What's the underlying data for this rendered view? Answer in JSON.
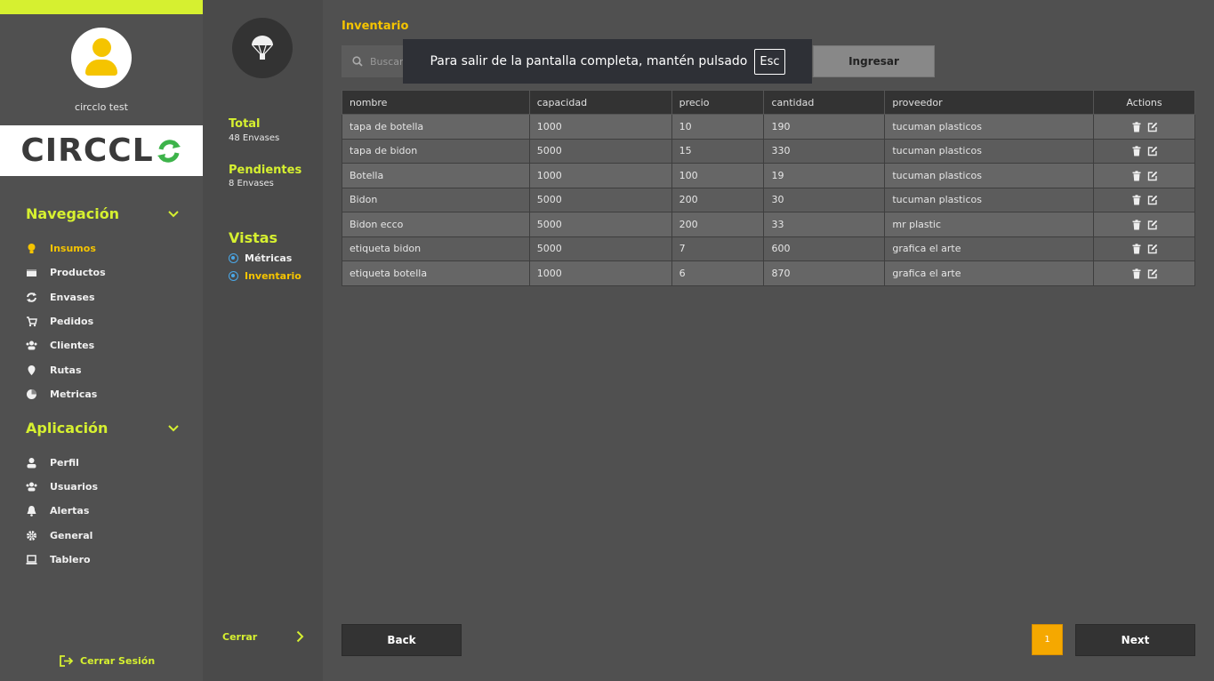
{
  "sidebar": {
    "username": "circclo test",
    "logo_text": "CIRCCL",
    "nav_heading": "Navegación",
    "nav_items": [
      {
        "label": "Insumos",
        "icon": "lightbulb-icon"
      },
      {
        "label": "Productos",
        "icon": "box-icon"
      },
      {
        "label": "Envases",
        "icon": "recycle-icon"
      },
      {
        "label": "Pedidos",
        "icon": "cart-icon"
      },
      {
        "label": "Clientes",
        "icon": "users-icon"
      },
      {
        "label": "Rutas",
        "icon": "map-pin-icon"
      },
      {
        "label": "Metricas",
        "icon": "pie-chart-icon"
      }
    ],
    "app_heading": "Aplicación",
    "app_items": [
      {
        "label": "Perfil",
        "icon": "user-icon"
      },
      {
        "label": "Usuarios",
        "icon": "users-icon"
      },
      {
        "label": "Alertas",
        "icon": "bell-icon"
      },
      {
        "label": "General",
        "icon": "gear-icon"
      },
      {
        "label": "Tablero",
        "icon": "laptop-icon"
      }
    ],
    "logout_label": "Cerrar Sesión"
  },
  "column2": {
    "total_title": "Total",
    "total_sub": "48 Envases",
    "pending_title": "Pendientes",
    "pending_sub": "8 Envases",
    "vistas_title": "Vistas",
    "vistas": [
      "Métricas",
      "Inventario"
    ],
    "close_label": "Cerrar"
  },
  "main": {
    "title": "Inventario",
    "search_placeholder": "Buscar",
    "submit_label": "Ingresar",
    "fullscreen_notice": "Para salir de la pantalla completa, mantén pulsado",
    "fullscreen_key": "Esc",
    "columns": [
      "nombre",
      "capacidad",
      "precio",
      "cantidad",
      "proveedor",
      "Actions"
    ],
    "rows": [
      [
        "tapa de botella",
        "1000",
        "10",
        "190",
        "tucuman plasticos"
      ],
      [
        "tapa de bidon",
        "5000",
        "15",
        "330",
        "tucuman plasticos"
      ],
      [
        "Botella",
        "1000",
        "100",
        "19",
        "tucuman plasticos"
      ],
      [
        "Bidon",
        "5000",
        "200",
        "30",
        "tucuman plasticos"
      ],
      [
        "Bidon ecco",
        "5000",
        "200",
        "33",
        "mr plastic"
      ],
      [
        "etiqueta bidon",
        "5000",
        "7",
        "600",
        "grafica el arte"
      ],
      [
        "etiqueta botella",
        "1000",
        "6",
        "870",
        "grafica el arte"
      ]
    ],
    "back_label": "Back",
    "page": "1",
    "next_label": "Next"
  },
  "colors": {
    "accent_green": "#d6f030",
    "accent_yellow": "#f5c400",
    "page_orange": "#f5a800"
  }
}
